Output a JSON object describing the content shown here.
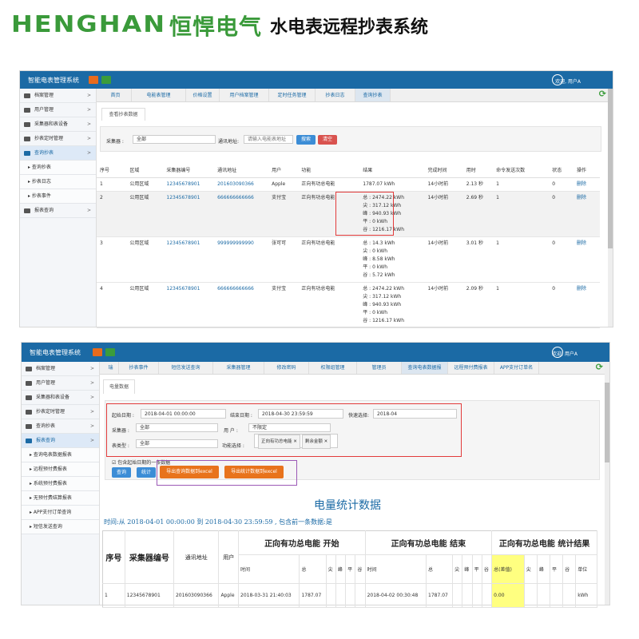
{
  "header": {
    "logo_en": "HENGHAN",
    "logo_cn": "恒悍电气",
    "title": "水电表远程抄表系统"
  },
  "top": {
    "app_title": "智能电表管理系统",
    "user": "欢迎, 用户A",
    "sidebar": [
      {
        "label": "档案管理",
        "arrow": ">"
      },
      {
        "label": "用户管理",
        "arrow": ">"
      },
      {
        "label": "采集器和表设备",
        "arrow": ">"
      },
      {
        "label": "抄表定时管理",
        "arrow": ">"
      },
      {
        "label": "查询抄表",
        "arrow": ">"
      },
      {
        "label": "▸ 查询抄表"
      },
      {
        "label": "▸ 抄表日志"
      },
      {
        "label": "▸ 抄表事件"
      },
      {
        "label": "报表查询",
        "arrow": ">"
      }
    ],
    "nav": [
      "首页",
      "电能表管理",
      "价格设置",
      "用户档案管理",
      "定时任务管理",
      "抄表日志",
      "查询抄表"
    ],
    "tab": "查看抄表数据",
    "filter": {
      "collector_label": "采集器 :",
      "collector_value": "全部",
      "addr_label": "通讯地址:",
      "addr_placeholder": "请输入电能表地址",
      "search": "搜索",
      "clear": "清空"
    },
    "columns": [
      "序号",
      "区域",
      "采集器编号",
      "通讯地址",
      "用户",
      "功能",
      "结果",
      "完成时间",
      "用时",
      "命令发送次数",
      "状态",
      "操作"
    ],
    "rows": [
      {
        "no": "1",
        "area": "公用区域",
        "collector": "12345678901",
        "addr": "201603090366",
        "user": "Apple",
        "func": "正向有功总电能",
        "result": [
          "1787.07 kWh"
        ],
        "time": "14小时前",
        "dur": "2.13 秒",
        "count": "1",
        "status": "0",
        "op": "删除"
      },
      {
        "no": "2",
        "area": "公用区域",
        "collector": "12345678901",
        "addr": "666666666666",
        "user": "支付宝",
        "func": "正向有功总电能",
        "result": [
          "总 : 2474.22 kWh",
          "尖 : 317.12 kWh",
          "峰 : 940.93 kWh",
          "平 : 0 kWh",
          "谷 : 1216.17 kWh"
        ],
        "time": "14小时前",
        "dur": "2.69 秒",
        "count": "1",
        "status": "0",
        "op": "删除"
      },
      {
        "no": "3",
        "area": "公用区域",
        "collector": "12345678901",
        "addr": "999999999990",
        "user": "张可可",
        "func": "正向有功总电能",
        "result": [
          "总 : 14.3 kWh",
          "尖 : 0 kWh",
          "峰 : 8.58 kWh",
          "平 : 0 kWh",
          "谷 : 5.72 kWh"
        ],
        "time": "14小时前",
        "dur": "3.01 秒",
        "count": "1",
        "status": "0",
        "op": "删除"
      },
      {
        "no": "4",
        "area": "公用区域",
        "collector": "12345678901",
        "addr": "666666666666",
        "user": "支付宝",
        "func": "正向有功总电能",
        "result": [
          "总 : 2474.22 kWh",
          "尖 : 317.12 kWh",
          "峰 : 940.93 kWh",
          "平 : 0 kWh",
          "谷 : 1216.17 kWh"
        ],
        "time": "14小时前",
        "dur": "2.09 秒",
        "count": "1",
        "status": "0",
        "op": "删除"
      }
    ]
  },
  "bottom": {
    "app_title": "智能电表管理系统",
    "user": "欢迎, 用户A",
    "sidebar": [
      {
        "label": "档案管理",
        "arrow": ">"
      },
      {
        "label": "用户管理",
        "arrow": ">"
      },
      {
        "label": "采集器和表设备",
        "arrow": ">"
      },
      {
        "label": "抄表定时管理",
        "arrow": ">"
      },
      {
        "label": "查询抄表",
        "arrow": ">"
      },
      {
        "label": "报表查询",
        "arrow": ">"
      },
      {
        "label": "▸ 查询电表数据报表"
      },
      {
        "label": "▸ 远程预付费报表"
      },
      {
        "label": "▸ 系统预付费报表"
      },
      {
        "label": "▸ 无预付费结算报表"
      },
      {
        "label": "▸ APP支付订单查询"
      },
      {
        "label": "▸ 短信发送查询"
      }
    ],
    "nav": [
      "瑞",
      "抄表事件",
      "短信发送查询",
      "采集器管理",
      "修改密码",
      "权限组管理",
      "管理员",
      "查询电表数据报",
      "远程预付费报表",
      "APP支付订单名"
    ],
    "tab": "电量数据",
    "filter": {
      "start_label": "起始日期 :",
      "start_value": "2018-04-01 00:00:00",
      "end_label": "结束日期 :",
      "end_value": "2018-04-30 23:59:59",
      "quick_label": "快速选择:",
      "quick_value": "2018-04",
      "collector_label": "采集器 :",
      "collector_value": "全部",
      "user_label": "用  户 :",
      "user_value": "不限定",
      "meter_label": "表类型 :",
      "meter_value": "全部",
      "func_label": "功能选择 :",
      "func_tags": [
        "正向有功总电能 ✕",
        "剩余金额 ✕"
      ],
      "include_label": "包含起始日期的一条数据",
      "query": "查询",
      "stats": "统计",
      "export1": "导出查询数据到excel",
      "export2": "导出统计数据到excel"
    },
    "report_title": "电量统计数据",
    "report_info": "时间:从 2018-04-01 00:00:00 到 2018-04-30 23:59:59 , 包含前一条数据:是",
    "head_big": [
      "序号",
      "采集器编号",
      "通讯地址",
      "用户",
      "正向有功总电能 开始",
      "正向有功总电能 结束",
      "正向有功总电能 统计结果"
    ],
    "sub_start": [
      "时间",
      "总",
      "尖",
      "峰",
      "平",
      "谷"
    ],
    "sub_end": [
      "时间",
      "总",
      "尖",
      "峰",
      "平",
      "谷"
    ],
    "sub_stat": [
      "总(差值)",
      "尖",
      "峰",
      "平",
      "谷",
      "单位"
    ],
    "row": {
      "no": "1",
      "collector": "12345678901",
      "addr": "201603090366",
      "user": "Apple",
      "t1": "2018-03-31 21:40:03",
      "v1": "1787.07",
      "t2": "2018-04-02 00:30:48",
      "v2": "1787.07",
      "diff": "0.00",
      "unit": "kWh"
    }
  }
}
